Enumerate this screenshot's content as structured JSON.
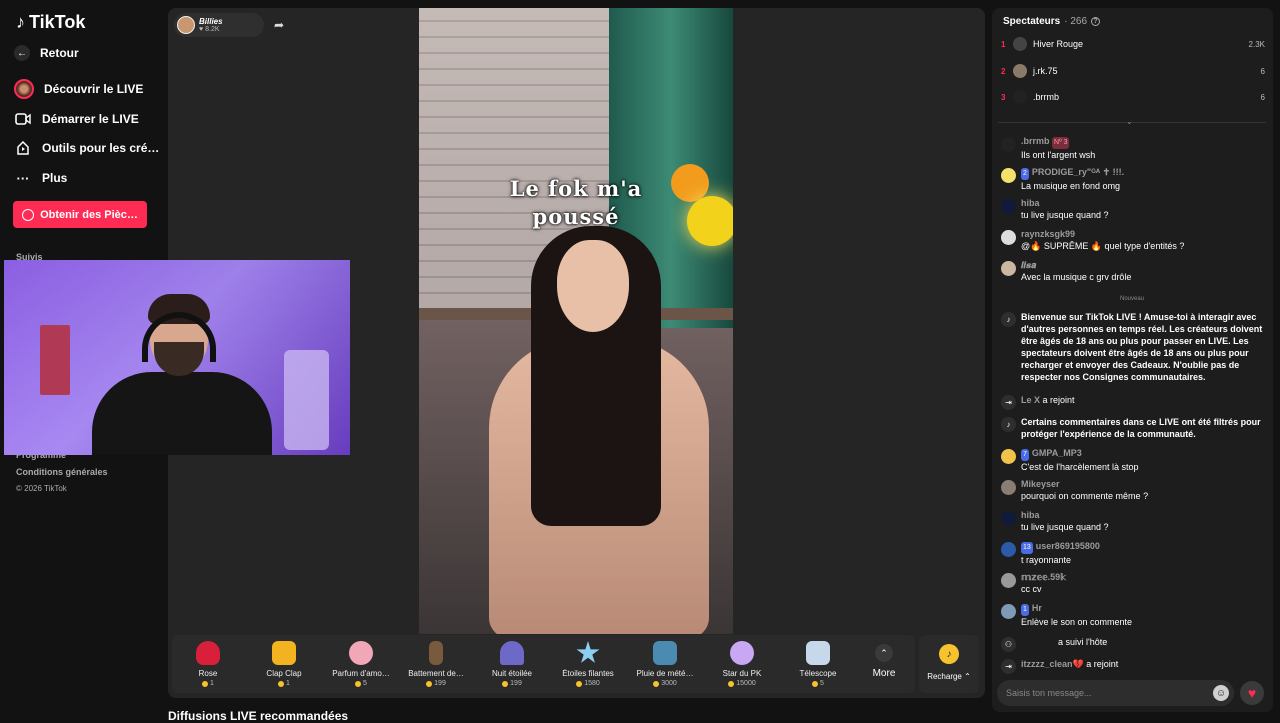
{
  "sidebar": {
    "logo": "TikTok",
    "back": "Retour",
    "items": [
      {
        "label": "Découvrir le LIVE",
        "icon": "avatar-icon"
      },
      {
        "label": "Démarrer le LIVE",
        "icon": "video-camera-icon"
      },
      {
        "label": "Outils pour les cré…",
        "icon": "creator-tools-icon"
      },
      {
        "label": "Plus",
        "icon": "more-dots-icon"
      }
    ],
    "coins_button": "Obtenir des Pièc…",
    "following_label": "Suivis",
    "footer": [
      "Programme",
      "Conditions générales",
      "© 2026 TikTok"
    ]
  },
  "host": {
    "name": "Billies",
    "likes": "8.2K"
  },
  "video": {
    "overlay_line1": "Le fok m'a",
    "overlay_line2": "poussé"
  },
  "gifts": [
    {
      "name": "Rose",
      "price": "1",
      "color": "#d8203a"
    },
    {
      "name": "Clap Clap",
      "price": "1",
      "color": "#f3b321"
    },
    {
      "name": "Parfum d'amo…",
      "price": "5",
      "color": "#f2a7b8"
    },
    {
      "name": "Battement de…",
      "price": "199",
      "color": "#7a5a3c"
    },
    {
      "name": "Nuit étoilée",
      "price": "199",
      "color": "#6e69c9"
    },
    {
      "name": "Étoiles filantes",
      "price": "1580",
      "color": "#8bd0f0"
    },
    {
      "name": "Pluie de mété…",
      "price": "3000",
      "color": "#4b8bb2"
    },
    {
      "name": "Star du PK",
      "price": "15000",
      "color": "#c9a7f2"
    },
    {
      "name": "Télescope",
      "price": "5",
      "color": "#c7d8ea"
    }
  ],
  "more_label": "More",
  "recharge_label": "Recharge",
  "recommended_title": "Diffusions LIVE recommandées",
  "viewers": {
    "title": "Spectateurs",
    "count": "266",
    "top": [
      {
        "rank": "1",
        "name": "Hiver Rouge",
        "score": "2.3K"
      },
      {
        "rank": "2",
        "name": "j.rk.75",
        "score": "6"
      },
      {
        "rank": "3",
        "name": ".brrmb",
        "score": "6"
      }
    ]
  },
  "chat": {
    "messages": [
      {
        "user": ".brrmb",
        "badge": "Nº 3",
        "text": "Ils ont l'argent wsh"
      },
      {
        "user": "PRODIGE_ry\"ᴳᴬ ✝ !!!.",
        "badge": "2",
        "text": "La musique en fond omg"
      },
      {
        "user": "hiba",
        "badge": "",
        "text": "tu live jusque quand ?"
      },
      {
        "user": "raynzksgk99",
        "badge": "",
        "text": "@🔥 SUPRÊME 🔥 quel type d'entités ?"
      },
      {
        "user": "𝒍𝒊𝒔𝒂",
        "badge": "",
        "text": "Avec la musique c grv drôle"
      }
    ],
    "nouveau": "Nouveau",
    "welcome": "Bienvenue sur TikTok LIVE ! Amuse-toi à interagir avec d'autres personnes en temps réel. Les créateurs doivent être âgés de 18 ans ou plus pour passer en LIVE. Les spectateurs doivent être âgés de 18 ans ou plus pour recharger et envoyer des Cadeaux. N'oublie pas de respecter nos Consignes communautaires.",
    "joined1_user": "Le X",
    "joined1_text": "a rejoint",
    "filter_notice": "Certains commentaires dans ce LIVE ont été filtrés pour protéger l'expérience de la communauté.",
    "messages2": [
      {
        "user": "GMPA_MP3",
        "badge": "7",
        "text": "C'est de l'harcèlement là stop"
      },
      {
        "user": "Mikeyser",
        "badge": "",
        "text": "pourquoi on commente même ?"
      },
      {
        "user": "hiba",
        "badge": "",
        "text": "tu live jusque quand ?"
      },
      {
        "user": "user869195800",
        "badge": "13",
        "text": "t rayonnante"
      },
      {
        "user": "𝕞𝕫𝕖𝕖.59𝕜",
        "badge": "",
        "text": "cc cv"
      },
      {
        "user": "Hr",
        "badge": "1",
        "text": "Enlève le son on commente"
      }
    ],
    "followed_text": "a suivi l'hôte",
    "joined2_user": "itzzzz_clean💔",
    "joined2_text": "a rejoint",
    "input_placeholder": "Saisis ton message..."
  }
}
